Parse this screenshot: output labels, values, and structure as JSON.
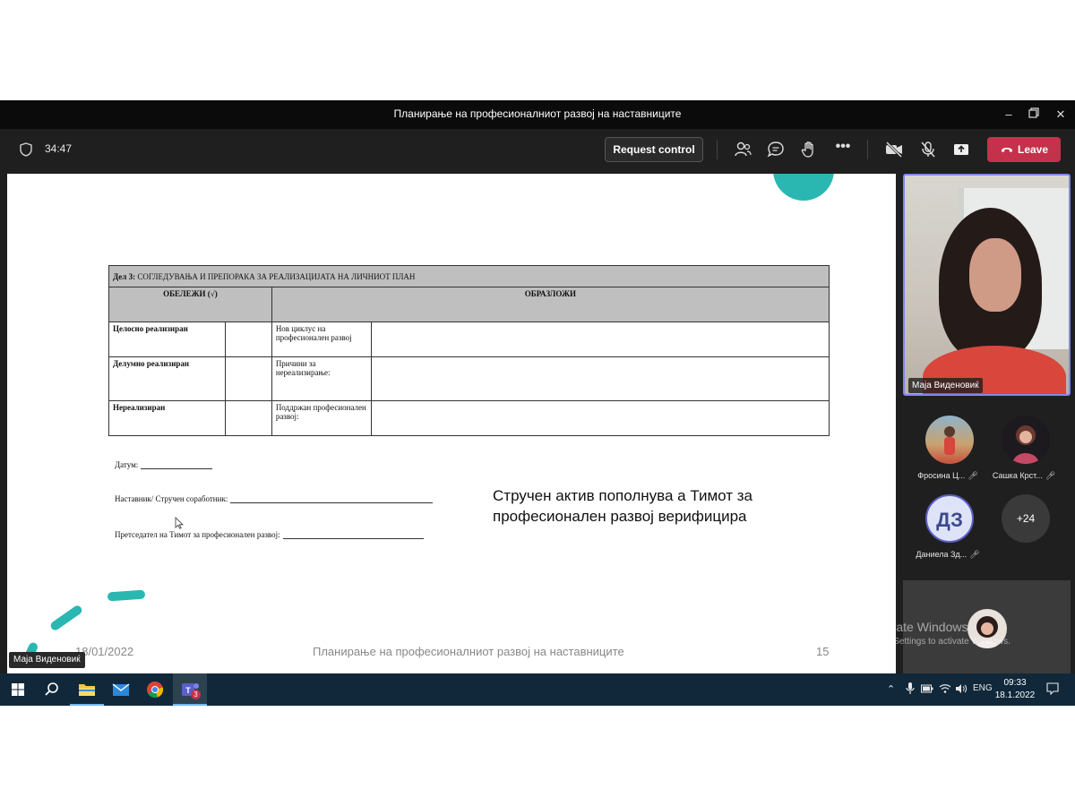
{
  "window": {
    "title": "Планирање на професионалниот развој на наставниците"
  },
  "toolbar": {
    "timer": "34:47",
    "request_control_label": "Request control",
    "leave_label": "Leave"
  },
  "slide": {
    "table": {
      "section_header_bold": "Дел 3:",
      "section_header_rest": " СОГЛЕДУВАЊА И ПРЕПОРАКА ЗА РЕАЛИЗАЦИЈАТА НА ЛИЧНИОТ ПЛАН",
      "col1_header": "ОБЕЛЕЖИ (√)",
      "col2_header": "ОБРАЗЛОЖИ",
      "rows": [
        {
          "status": "Целосно реализиран",
          "label": "Нов циклус на професионален развој"
        },
        {
          "status": "Делумно реализиран",
          "label": "Причини за нереализирање:"
        },
        {
          "status": "Нереализиран",
          "label": "Поддржан професионален развој:"
        }
      ]
    },
    "signatures": {
      "date_label": "Датум:",
      "teacher_label": "Наставник/ Стручен соработник:",
      "president_label": "Претседател на Тимот за професионален развој:"
    },
    "note_line1": "Стручен актив пополнува а Тимот за",
    "note_line2": "професионален развој верифицира",
    "footer_date": "18/01/2022",
    "footer_title": "Планирање на професионалниот развој на наставниците",
    "footer_page": "15",
    "presenter_name": "Маја Виденовиќ"
  },
  "participants": {
    "self_name": "Маја Виденовиќ",
    "tiles": [
      {
        "name": "Фросина Ц..."
      },
      {
        "name": "Сашка Крст..."
      },
      {
        "name": "Даниела Зд...",
        "initials": "ДЗ"
      }
    ],
    "more_count": "+24"
  },
  "watermark": {
    "line1": "Activate Windows",
    "line2": "Go to Settings to activate Windows."
  },
  "taskbar": {
    "teams_badge": "3",
    "language": "ENG",
    "time": "09:33",
    "date": "18.1.2022"
  },
  "colors": {
    "accent_teal": "#2ab7b1",
    "leave_red": "#c4314b",
    "teams_purple": "#5b5fc7"
  }
}
